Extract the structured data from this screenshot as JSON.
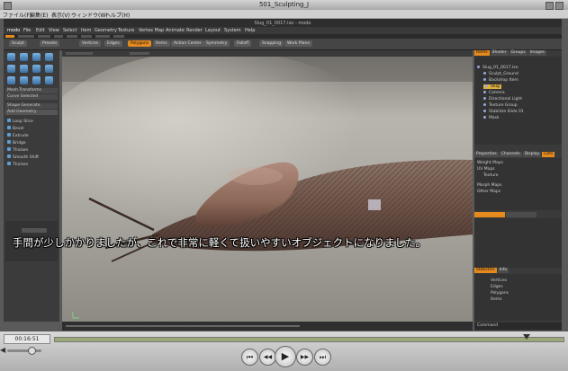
{
  "player": {
    "title": "501_Sculpting_J",
    "menu": [
      "ファイル(F)",
      "編集(E)",
      "表示(V)",
      "ウィンドウ(W)",
      "ヘルプ(H)"
    ],
    "time": "00:16:51",
    "seek_progress": 0.93,
    "volume_level": 0.7,
    "controls": {
      "begin_icon": "⏮",
      "back_icon": "◀◀",
      "play_icon": "▶",
      "forward_icon": "▶▶",
      "end_icon": "⏭"
    }
  },
  "modo": {
    "title": "Slug_01_0017.lxo - modo",
    "menu": [
      "modo",
      "File",
      "Edit",
      "View",
      "Select",
      "Item",
      "Geometry",
      "Texture",
      "Vertex Map",
      "Animate",
      "Render",
      "Layout",
      "System",
      "Help"
    ],
    "toolbar": [
      "Sculpt",
      "Presets",
      "Vertices",
      "Edges",
      "Polygons",
      "Items",
      "Action Center",
      "Symmetry",
      "Falloff",
      "Snapping",
      "Work Plane"
    ],
    "left_sections": [
      "Mesh Transforms",
      "Curve Selected",
      "Shape Generate",
      "Add Geometry"
    ],
    "left_items": [
      "Loop Slice",
      "Bevel",
      "Extrude",
      "Bridge",
      "Thicken",
      "Smooth Shift",
      "Thicken"
    ],
    "item_list": [
      "Slug_01_0017.lxo",
      "Sculpt_Ground",
      "Backdrop Item",
      "Slug",
      "Camera",
      "Directional Light",
      "Texture Group",
      "Stabilize Slide 01",
      "Mask"
    ],
    "right_tabs": [
      "Items",
      "Shader",
      "Groups",
      "Images"
    ],
    "vmap_tabs": [
      "Properties",
      "Channels",
      "Display",
      "Lists"
    ],
    "vmap_items": [
      "Weight Maps",
      "UV Maps",
      "Texture",
      "Morph Maps",
      "Other Maps"
    ],
    "stats_tabs": [
      "Statistics",
      "Info"
    ],
    "stats_items": [
      "Vertices",
      "Edges",
      "Polygons",
      "Items"
    ],
    "command_label": "Command"
  },
  "subtitle": "手間が少しかかりましたが、これで非常に軽くて扱いやすいオブジェクトになりました。",
  "colors": {
    "accent": "#e68a1e",
    "subtitle_text": "#ffffff"
  }
}
